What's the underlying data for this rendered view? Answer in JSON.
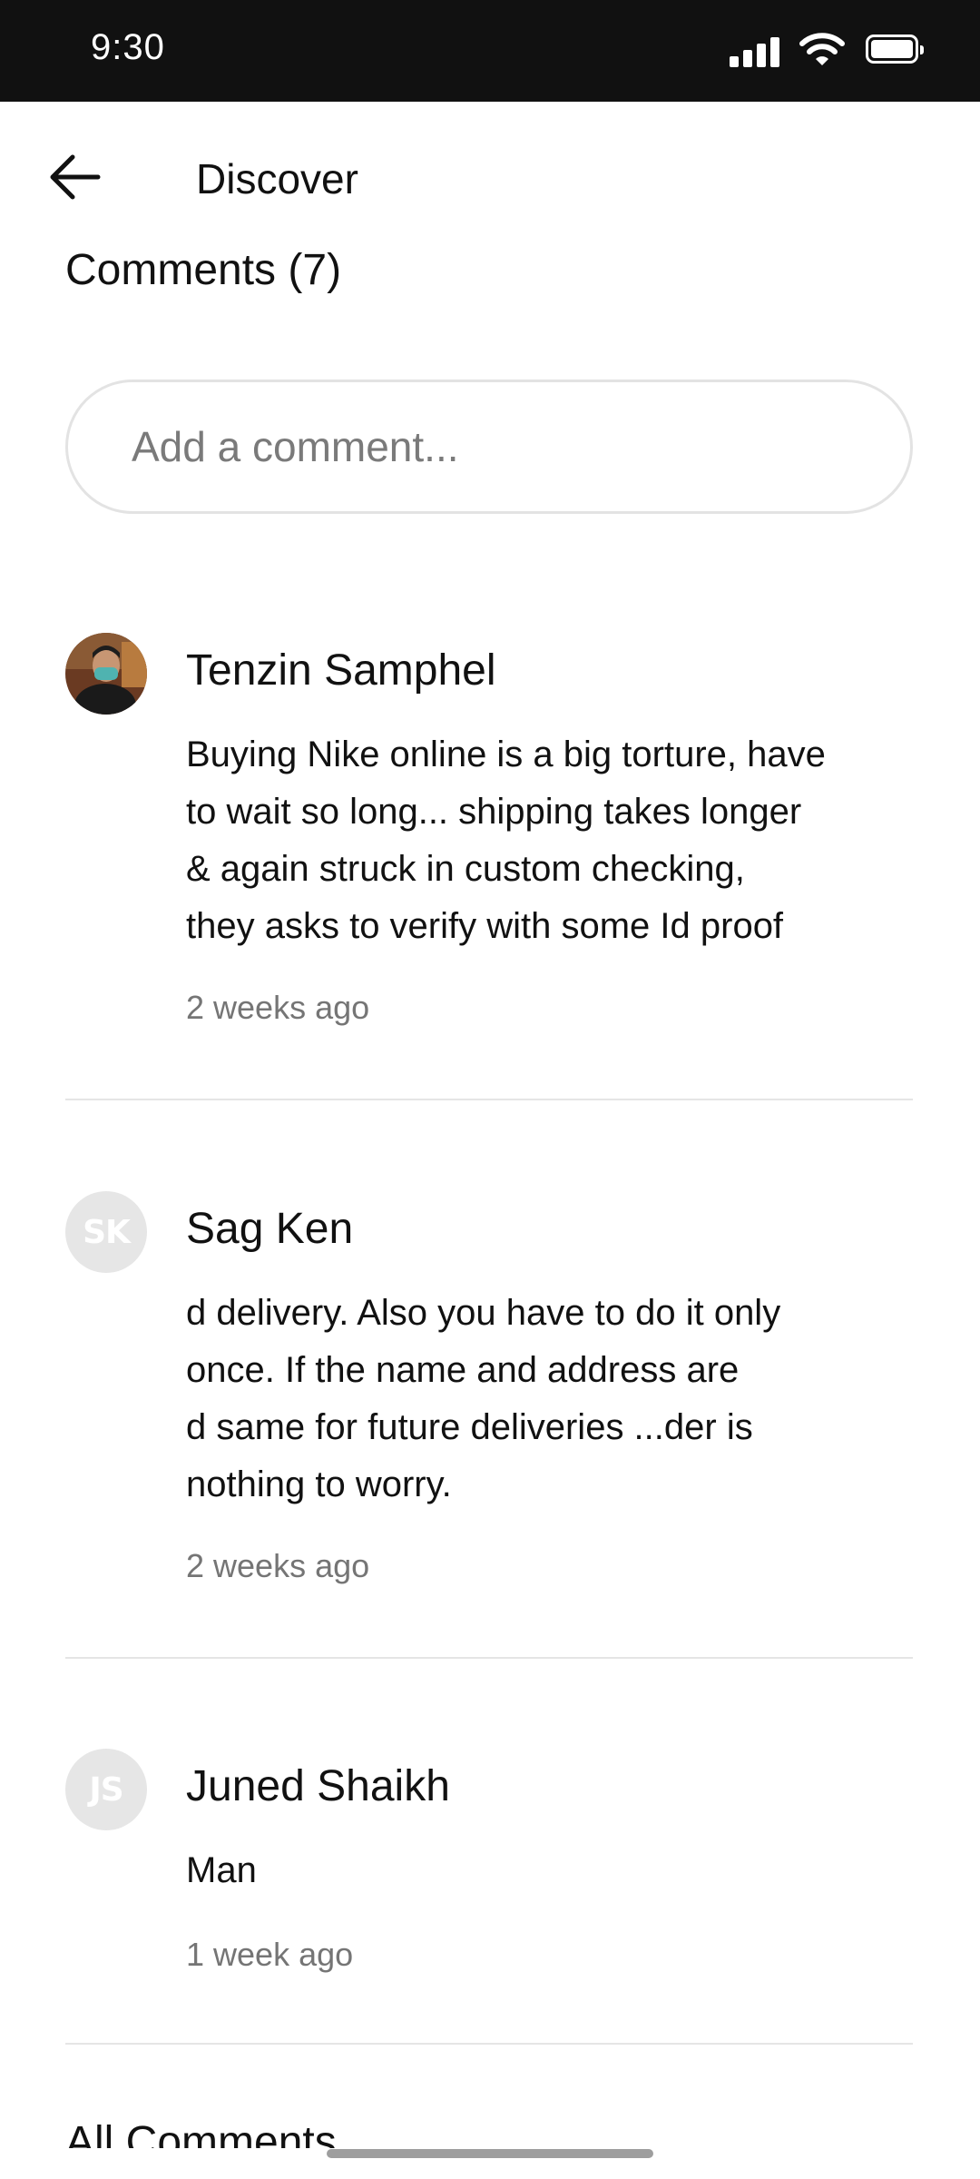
{
  "status_bar": {
    "time": "9:30"
  },
  "header": {
    "title": "Discover",
    "back_icon": "arrow-left-icon"
  },
  "comments_heading": "Comments (7)",
  "comment_input": {
    "placeholder": "Add a comment...",
    "value": ""
  },
  "comments": [
    {
      "name": "Tenzin Samphel",
      "avatar": "photo",
      "lines": [
        "Buying Nike online is a big torture, have",
        "to wait so long... shipping takes longer",
        "& again struck in custom checking,",
        "they asks to verify with some Id proof"
      ],
      "time": "2 weeks ago"
    },
    {
      "name": "Sag Ken",
      "avatar": "SK",
      "lines": [
        "d delivery. Also you have to do it only",
        "once. If the name and address are",
        "d same for future deliveries ...der is",
        "nothing to worry."
      ],
      "time": "2 weeks ago"
    },
    {
      "name": "Juned Shaikh",
      "avatar": "JS",
      "lines": [
        "Man"
      ],
      "time": "1 week ago"
    }
  ],
  "section_heading": "All Comments",
  "colors": {
    "status_bar_bg": "#111111",
    "divider": "#e5e5e5",
    "secondary_text": "#757575",
    "avatar_bg": "#e6e6e6"
  }
}
